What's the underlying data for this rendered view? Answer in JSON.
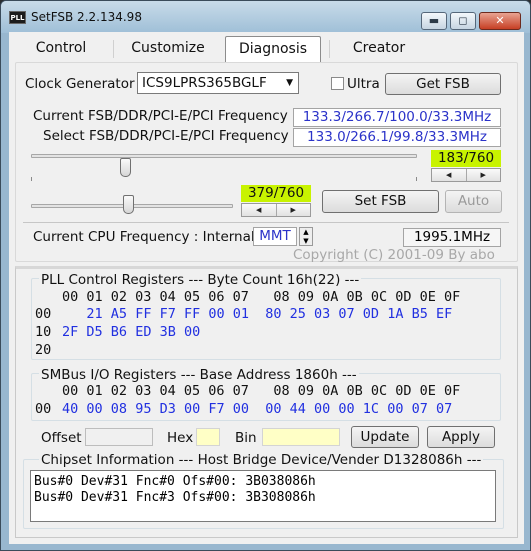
{
  "window": {
    "title": "SetFSB 2.2.134.98",
    "app_icon": "PLL"
  },
  "tabs": [
    "Control",
    "Customize",
    "Diagnosis",
    "Creator"
  ],
  "clock_generator": {
    "label": "Clock Generator",
    "value": "ICS9LPRS365BGLF",
    "ultra_label": "Ultra",
    "get_fsb_label": "Get FSB"
  },
  "freq": {
    "current_label": "Current FSB/DDR/PCI-E/PCI Frequency",
    "current_value": "133.3/266.7/100.0/33.3MHz",
    "select_label": "Select FSB/DDR/PCI-E/PCI Frequency",
    "select_value": "133.0/266.1/99.8/33.3MHz"
  },
  "slider1": {
    "readout": "183/760",
    "position": 183,
    "max": 760
  },
  "slider2": {
    "readout": "379/760",
    "position": 379,
    "max": 760
  },
  "set_fsb_label": "Set FSB",
  "auto_label": "Auto",
  "cpu": {
    "label": "Current CPU Frequency : Internal",
    "mode": "MMT",
    "value": "1995.1MHz"
  },
  "copyright": "Copyright (C) 2001-09 By abo",
  "pll": {
    "title": "PLL Control Registers  --- Byte Count 16h(22) ---",
    "header": "00 01 02 03 04 05 06 07   08 09 0A 0B 0C 0D 0E 0F",
    "row_labels": [
      "00",
      "10",
      "20"
    ],
    "row00": [
      "21",
      "A5",
      "FF",
      "F7",
      "FF",
      "00",
      "01",
      "80",
      "25",
      "03",
      "07",
      "0D",
      "1A",
      "B5",
      "EF"
    ],
    "row00_first": "00",
    "row10": [
      "2F",
      "D5",
      "B6",
      "ED",
      "3B",
      "00"
    ]
  },
  "smbus": {
    "title": "SMBus I/O Registers  --- Base Address 1860h ---",
    "header": "00 01 02 03 04 05 06 07   08 09 0A 0B 0C 0D 0E 0F",
    "row_label": "00",
    "row": [
      "40",
      "00",
      "08",
      "95",
      "D3",
      "00",
      "F7",
      "00",
      "00",
      "44",
      "00",
      "00",
      "1C",
      "00",
      "07",
      "07"
    ]
  },
  "offset": {
    "offset_label": "Offset",
    "hex_label": "Hex",
    "bin_label": "Bin",
    "update_label": "Update",
    "apply_label": "Apply"
  },
  "chipset": {
    "title": "Chipset Information  --- Host Bridge Device/Vender D1328086h ---",
    "lines": [
      "Bus#0 Dev#31 Fnc#0 Ofs#00: 3B038086h",
      "Bus#0 Dev#31 Fnc#3 Ofs#00: 3B308086h"
    ]
  },
  "colors": {
    "accent_green": "#c8f300",
    "value_blue": "#2b33c9",
    "register_blue": "#2130e0"
  },
  "icons": [
    "minimize-icon",
    "maximize-icon",
    "close-icon",
    "dropdown-arrow-icon",
    "spin-left-icon",
    "spin-right-icon",
    "spin-up-icon",
    "spin-down-icon"
  ]
}
